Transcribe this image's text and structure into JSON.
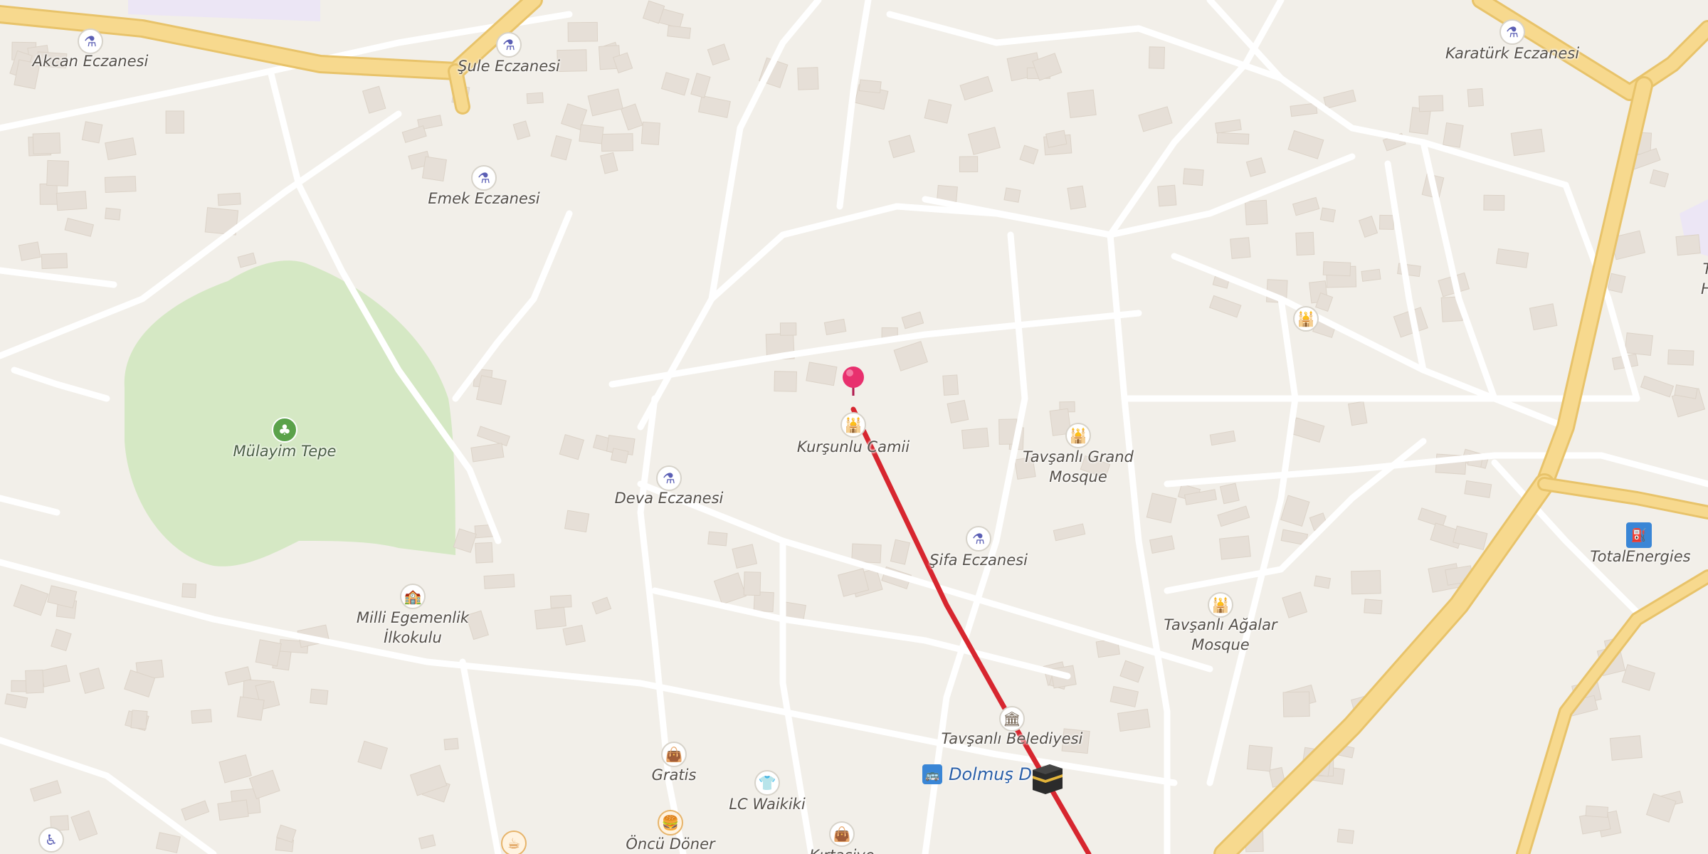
{
  "map": {
    "colors": {
      "land": "#f2efe9",
      "road_minor": "#ffffff",
      "road_major": "#f7d98e",
      "road_major_casing": "#e8c36a",
      "building": "#e6dfd7",
      "park": "#d5e8c4",
      "route_line": "#d7262f",
      "marker": "#e8306e",
      "poi_icon_pharmacy": "#5b5fb5",
      "label_text": "#55504a"
    },
    "pois": [
      {
        "name": "Akcan Eczanesi",
        "type": "pharmacy",
        "icon": "pharmacy-icon"
      },
      {
        "name": "Şule Eczanesi",
        "type": "pharmacy",
        "icon": "pharmacy-icon"
      },
      {
        "name": "Emek Eczanesi",
        "type": "pharmacy",
        "icon": "pharmacy-icon"
      },
      {
        "name": "Karatürk Eczanesi",
        "type": "pharmacy",
        "icon": "pharmacy-icon"
      },
      {
        "name": "Mülayim Tepe",
        "type": "park",
        "icon": "tree-icon"
      },
      {
        "name": "Kurşunlu Camii",
        "type": "mosque",
        "icon": "mosque-icon"
      },
      {
        "name": "Tavşanlı Grand Mosque",
        "type": "mosque",
        "icon": "mosque-icon"
      },
      {
        "name": "Deva Eczanesi",
        "type": "pharmacy",
        "icon": "pharmacy-icon"
      },
      {
        "name": "Şifa Eczanesi",
        "type": "pharmacy",
        "icon": "pharmacy-icon"
      },
      {
        "name": "Milli Egemenlik İlkokulu",
        "type": "school",
        "icon": "school-icon"
      },
      {
        "name": "Tavşanlı Ağalar Mosque",
        "type": "mosque",
        "icon": "mosque-icon"
      },
      {
        "name": "TotalEnergies",
        "type": "fuel",
        "icon": "fuel-icon"
      },
      {
        "name": "Tavşanlı Belediyesi",
        "type": "gov",
        "icon": "townhall-icon"
      },
      {
        "name": "Gratis",
        "type": "shop",
        "icon": "shopping-bag-icon"
      },
      {
        "name": "LC Waikiki",
        "type": "shop",
        "icon": "clothes-icon"
      },
      {
        "name": "Dolmuş Du",
        "type": "bus",
        "icon": "bus-stop-icon"
      },
      {
        "name": "Öncü Döner",
        "type": "food",
        "icon": "burger-icon"
      },
      {
        "name": "Kırtasiye",
        "type": "shop",
        "icon": "shopping-bag-icon"
      },
      {
        "name": "Ta Ha",
        "type": "text",
        "icon": ""
      }
    ]
  }
}
